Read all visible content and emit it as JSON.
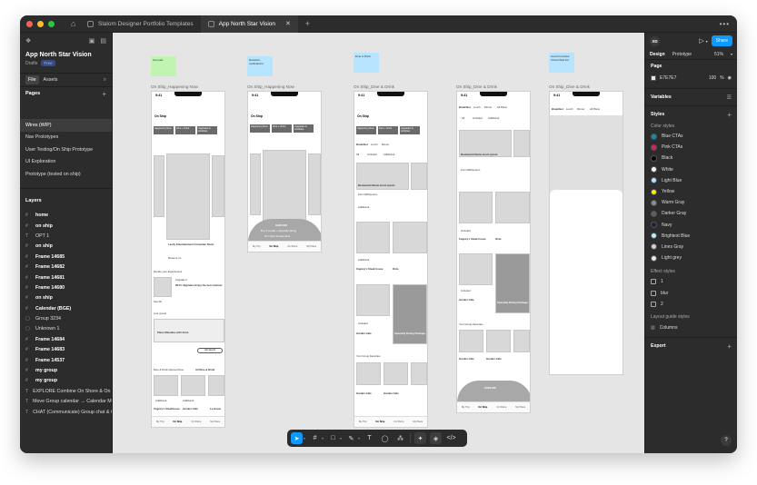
{
  "titlebar": {
    "tabs": [
      {
        "label": "Slalom Designer Portfolio Templates",
        "active": false
      },
      {
        "label": "App North Star Vision",
        "active": true
      }
    ]
  },
  "left_panel": {
    "file_title": "App North Star Vision",
    "drafts_label": "Drafts",
    "plan_badge": "Free",
    "tab_file": "File",
    "tab_assets": "Assets",
    "pages_heading": "Pages",
    "pages": [
      {
        "label": "Wires (WIP)",
        "selected": true
      },
      {
        "label": "Nav Prototypes",
        "selected": false
      },
      {
        "label": "User Testing/On Ship Prototype",
        "selected": false
      },
      {
        "label": "UI Exploration",
        "selected": false
      },
      {
        "label": "Prototype (tested on ship)",
        "selected": false
      }
    ],
    "layers_heading": "Layers",
    "layers": [
      {
        "icon": "#",
        "label": "home",
        "bold": true
      },
      {
        "icon": "#",
        "label": "on ship",
        "bold": true
      },
      {
        "icon": "T",
        "label": "OPT 1",
        "bold": false
      },
      {
        "icon": "#",
        "label": "on ship",
        "bold": true
      },
      {
        "icon": "#",
        "label": "Frame 14685",
        "bold": true
      },
      {
        "icon": "#",
        "label": "Frame 14682",
        "bold": true
      },
      {
        "icon": "#",
        "label": "Frame 14681",
        "bold": true
      },
      {
        "icon": "#",
        "label": "Frame 14680",
        "bold": true
      },
      {
        "icon": "#",
        "label": "on ship",
        "bold": true
      },
      {
        "icon": "#",
        "label": "Calendar (BGE)",
        "bold": true
      },
      {
        "icon": "▢",
        "label": "Group 3234",
        "bold": false
      },
      {
        "icon": "▢",
        "label": "Unknown 1",
        "bold": false
      },
      {
        "icon": "#",
        "label": "Frame 14684",
        "bold": true
      },
      {
        "icon": "#",
        "label": "Frame 14683",
        "bold": true
      },
      {
        "icon": "#",
        "label": "Frame 14537",
        "bold": true
      },
      {
        "icon": "#",
        "label": "my group",
        "bold": true
      },
      {
        "icon": "#",
        "label": "my group",
        "bold": true
      },
      {
        "icon": "T",
        "label": "EXPLORE Combine On Shore & On Ship",
        "bold": false
      },
      {
        "icon": "T",
        "label": "Move Group calendar → Calendar Mod",
        "bold": false
      },
      {
        "icon": "T",
        "label": "CHAT (Communicate) Group chat & Cr",
        "bold": false
      }
    ]
  },
  "canvas": {
    "frame_labels": [
      "On Ship_Happening Now",
      "On Ship_Happening Now",
      "On Ship_Dine & Drink",
      "On Ship_Dine & Drink",
      "On Ship_Dine & Drink"
    ],
    "stickies": [
      {
        "text": "Get paid",
        "color": "#bff5b0"
      },
      {
        "text": "Rewards, notifications",
        "color": "#b7e4ff"
      },
      {
        "text": "Dine & Drink",
        "color": "#b7e4ff"
      },
      {
        "text": "Avoid Crowded Virtual Wait list",
        "color": "#b7e4ff"
      }
    ],
    "phone": {
      "time": "9:41",
      "title": "On Ship",
      "chips": [
        "Happening Now",
        "Dine + Drink",
        "Upgrades & Activities"
      ],
      "tabs": [
        "My Trip",
        "On Ship",
        "On Shore",
        "My Plans"
      ]
    },
    "frame1_texts": {
      "event": "Levity Entertainment Comedian Show",
      "reserve": "Reserve no",
      "decide": "Decide your Experiences",
      "upgrade": "Upgrade it",
      "wifi": "Wi-Fi Upgrades Enjoy the best internet",
      "see_all": "See All",
      "your_group": "your group!",
      "event2": "Piano Melodies with Arnie",
      "join": "Join Event",
      "dine_open": "Dine & Drink Opened Now",
      "all_dine": "All Dine & Drink",
      "additional": "Additional",
      "place1": "Cagney's Steakhouse",
      "place2": "Garden Café",
      "place3": "La Gusta"
    },
    "frame2_texts": {
      "save": "SAVE $30",
      "save_sub": "Buy 3 credits + Specialty dining",
      "open": "Our Open Restaurants"
    },
    "frame3_texts": {
      "tabs": [
        "Breakfast",
        "Lunch",
        "Dinner",
        "All Plans",
        "see more time"
      ],
      "filters": [
        "All",
        "Included",
        "Additional"
      ],
      "rest": "Restaurant Name lorem ipsum",
      "price": "From $30/person",
      "additional": "Additional",
      "cagney": "Cagney's Steak house",
      "orde": "Orde",
      "garden": "Garden Cafe",
      "specialty": "Specialty Dining Package",
      "group_fav": "Your Group Favorites",
      "included": "Included"
    },
    "frame4_texts": {
      "save": "SAVE $30"
    }
  },
  "toolbar": {
    "tools": [
      "move-tool",
      "frame-tool",
      "shape-tool",
      "pen-tool",
      "text-tool",
      "comment-tool",
      "actions-tool",
      "dev-toggle-a",
      "dev-toggle-b",
      "code-tool"
    ]
  },
  "right_panel": {
    "avatar": "XD",
    "share": "Share",
    "tab_design": "Design",
    "tab_prototype": "Prototype",
    "zoom": "51%",
    "page_heading": "Page",
    "bg_hex": "E7E7E7",
    "bg_opacity": "100",
    "bg_unit": "%",
    "variables": "Variables",
    "styles": "Styles",
    "color_styles_heading": "Color styles",
    "color_styles": [
      {
        "name": "Blue CTAs",
        "color": "#0a8fb0"
      },
      {
        "name": "Pink CTAs",
        "color": "#e6176b"
      },
      {
        "name": "Black",
        "color": "#000000"
      },
      {
        "name": "White",
        "color": "#ffffff"
      },
      {
        "name": "Light Blue",
        "color": "#bfe3ff"
      },
      {
        "name": "Yellow",
        "color": "#fff200"
      },
      {
        "name": "Warm Gray",
        "color": "#8c8c8c"
      },
      {
        "name": "Darker Gray",
        "color": "#5e5e5e"
      },
      {
        "name": "Navy",
        "color": "#1a2240"
      },
      {
        "name": "Brightest Blue",
        "color": "#b5ecff"
      },
      {
        "name": "Lines Gray",
        "color": "#d0d0d0"
      },
      {
        "name": "Light grey",
        "color": "#e9e9e9"
      }
    ],
    "effect_styles_heading": "Effect styles",
    "effect_styles": [
      "1",
      "blur",
      "2"
    ],
    "layout_grid_heading": "Layout guide styles",
    "layout_grids": [
      "Columns"
    ],
    "export": "Export",
    "help": "?"
  }
}
